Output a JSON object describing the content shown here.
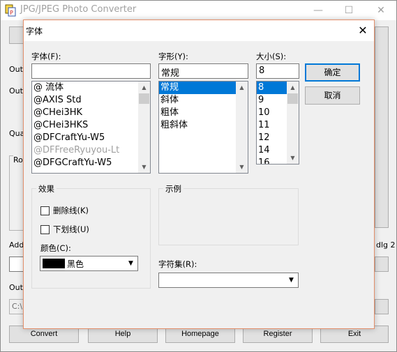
{
  "main_window": {
    "title": "JPG/JPEG Photo Converter",
    "labels": {
      "outp1": "Outp",
      "outp2": "Outp",
      "qua": "Qua",
      "ro": "Ro",
      "add": "Add",
      "dlg2": "dlg 2",
      "outp3": "Outp"
    },
    "path_value": "C:\\",
    "buttons": {
      "convert": "Convert",
      "help": "Help",
      "homepage": "Homepage",
      "register": "Register",
      "exit": "Exit"
    }
  },
  "font_dialog": {
    "title": "字体",
    "font_label": "字体(F):",
    "font_value": "",
    "font_list": [
      {
        "label": "@       流体",
        "state": "normal"
      },
      {
        "label": "@AXIS Std",
        "state": "normal"
      },
      {
        "label": "@CHei3HK",
        "state": "normal"
      },
      {
        "label": "@CHei3HKS",
        "state": "normal"
      },
      {
        "label": "@DFCraftYu-W5",
        "state": "normal"
      },
      {
        "label": "@DFFreeRyuyou-Lt",
        "state": "disabled"
      },
      {
        "label": "@DFGCraftYu-W5",
        "state": "normal"
      }
    ],
    "style_label": "字形(Y):",
    "style_value": "常规",
    "style_list": [
      {
        "label": "常规",
        "state": "selected"
      },
      {
        "label": "斜体",
        "state": "normal"
      },
      {
        "label": "粗体",
        "state": "normal"
      },
      {
        "label": "粗斜体",
        "state": "normal"
      }
    ],
    "size_label": "大小(S):",
    "size_value": "8",
    "size_list": [
      {
        "label": "8",
        "state": "selected"
      },
      {
        "label": "9",
        "state": "normal"
      },
      {
        "label": "10",
        "state": "normal"
      },
      {
        "label": "11",
        "state": "normal"
      },
      {
        "label": "12",
        "state": "normal"
      },
      {
        "label": "14",
        "state": "normal"
      },
      {
        "label": "16",
        "state": "normal"
      }
    ],
    "ok_label": "确定",
    "cancel_label": "取消",
    "effects_title": "效果",
    "strikeout_label": "删除线(K)",
    "underline_label": "下划线(U)",
    "color_label": "颜色(C):",
    "color_value": "黑色",
    "sample_title": "示例",
    "charset_label": "字符集(R):",
    "charset_value": "",
    "colors": {
      "selection": "#0078d7",
      "dialog_border": "#e38f6b",
      "swatch": "#000000"
    }
  }
}
